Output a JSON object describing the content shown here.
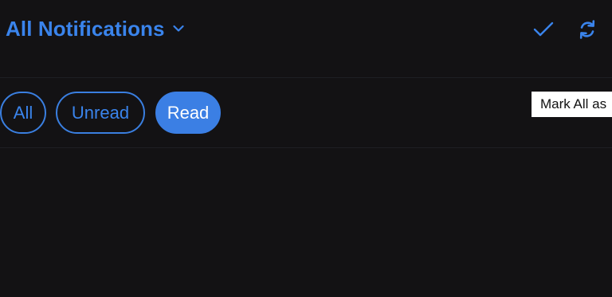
{
  "header": {
    "title": "All Notifications",
    "title_icon": "chevron-down-icon",
    "actions": [
      {
        "name": "mark-all-read",
        "icon": "check-icon"
      },
      {
        "name": "refresh",
        "icon": "refresh-icon"
      }
    ]
  },
  "filters": {
    "items": [
      {
        "label": "All",
        "selected": false
      },
      {
        "label": "Unread",
        "selected": false
      },
      {
        "label": "Read",
        "selected": true
      }
    ]
  },
  "tooltip": {
    "text": "Mark All as"
  },
  "colors": {
    "background": "#131214",
    "accent": "#3a84ec",
    "selected_fill": "#3b7fe4",
    "divider": "#1e1f23"
  }
}
